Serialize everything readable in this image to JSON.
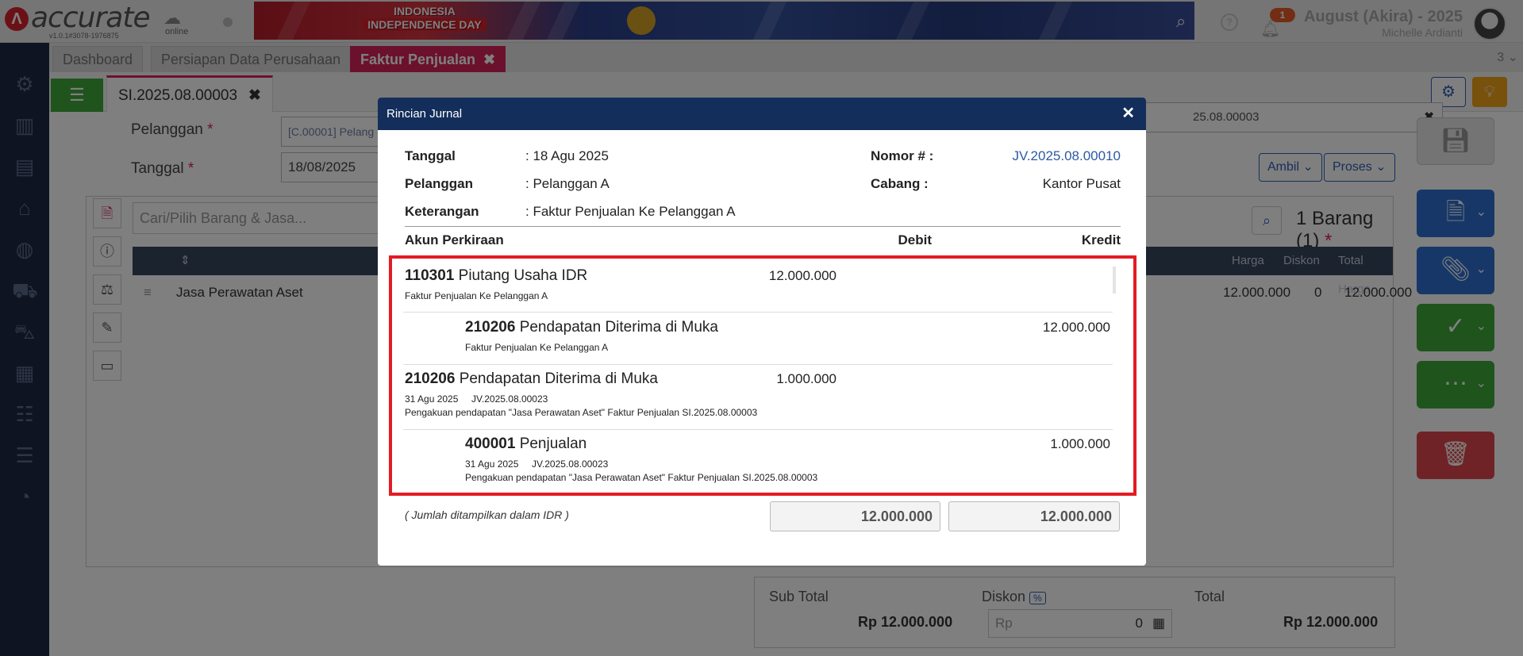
{
  "app": {
    "logo_text": "accurate",
    "logo_sub": "online",
    "version": "v1.0.1#3078-1976875",
    "banner_line1": "INDONESIA",
    "banner_line2": "INDEPENDENCE DAY",
    "notification_count": "1",
    "company": "August (Akira) - 2025",
    "user": "Michelle Ardianti",
    "help_label": "?"
  },
  "tabs": [
    {
      "label": "Dashboard"
    },
    {
      "label": "Persiapan Data Perusahaan"
    },
    {
      "label": "Faktur Penjualan",
      "close": "✖"
    }
  ],
  "tab_count": "3 ⌄",
  "doc_tab": {
    "label": "SI.2025.08.00003",
    "close": "✖"
  },
  "form": {
    "customer_label": "Pelanggan",
    "customer_value": "[C.00001] Pelang",
    "date_label": "Tanggal",
    "date_value": "18/08/2025",
    "required_mark": "*",
    "number_value": "25.08.00003",
    "clear": "✖"
  },
  "buttons": {
    "ambil": "Ambil",
    "proses": "Proses"
  },
  "items": {
    "search_placeholder": "Cari/Pilih Barang & Jasa...",
    "count": "1 Barang (1)",
    "headers": [
      "Harga",
      "Diskon",
      "Total Harga"
    ],
    "row": {
      "name": "Jasa Perawatan Aset",
      "price": "12.000.000",
      "discount": "0",
      "total": "12.000.000"
    }
  },
  "totals": {
    "subtotal_label": "Sub Total",
    "subtotal_value": "Rp 12.000.000",
    "discount_label": "Diskon",
    "discount_badge": "%",
    "discount_currency": "Rp",
    "discount_value": "0",
    "total_label": "Total",
    "total_value": "Rp 12.000.000"
  },
  "modal": {
    "title": "Rincian Jurnal",
    "close": "✕",
    "tanggal_label": "Tanggal",
    "tanggal_value": ": 18 Agu 2025",
    "pelanggan_label": "Pelanggan",
    "pelanggan_value": ": Pelanggan A",
    "keterangan_label": "Keterangan",
    "keterangan_value": ": Faktur Penjualan Ke Pelanggan A",
    "nomor_label": "Nomor # :",
    "nomor_value": "JV.2025.08.00010",
    "cabang_label": "Cabang :",
    "cabang_value": "Kantor Pusat",
    "col_account": "Akun Perkiraan",
    "col_debit": "Debit",
    "col_credit": "Kredit",
    "entries": [
      {
        "code": "110301",
        "name": "Piutang Usaha IDR",
        "date": "",
        "ref": "",
        "note": "Faktur Penjualan Ke Pelanggan A",
        "debit": "12.000.000",
        "credit": ""
      },
      {
        "code": "210206",
        "name": "Pendapatan Diterima di Muka",
        "date": "",
        "ref": "",
        "note": "Faktur Penjualan Ke Pelanggan A",
        "debit": "",
        "credit": "12.000.000"
      },
      {
        "code": "210206",
        "name": "Pendapatan Diterima di Muka",
        "date": "31 Agu 2025",
        "ref": "JV.2025.08.00023",
        "note": "Pengakuan pendapatan \"Jasa Perawatan Aset\" Faktur Penjualan SI.2025.08.00003",
        "debit": "1.000.000",
        "credit": ""
      },
      {
        "code": "400001",
        "name": "Penjualan",
        "date": "31 Agu 2025",
        "ref": "JV.2025.08.00023",
        "note": "Pengakuan pendapatan \"Jasa Perawatan Aset\" Faktur Penjualan SI.2025.08.00003",
        "debit": "",
        "credit": "1.000.000"
      }
    ],
    "note": "( Jumlah ditampilkan dalam IDR )",
    "total_debit": "12.000.000",
    "total_credit": "12.000.000"
  }
}
